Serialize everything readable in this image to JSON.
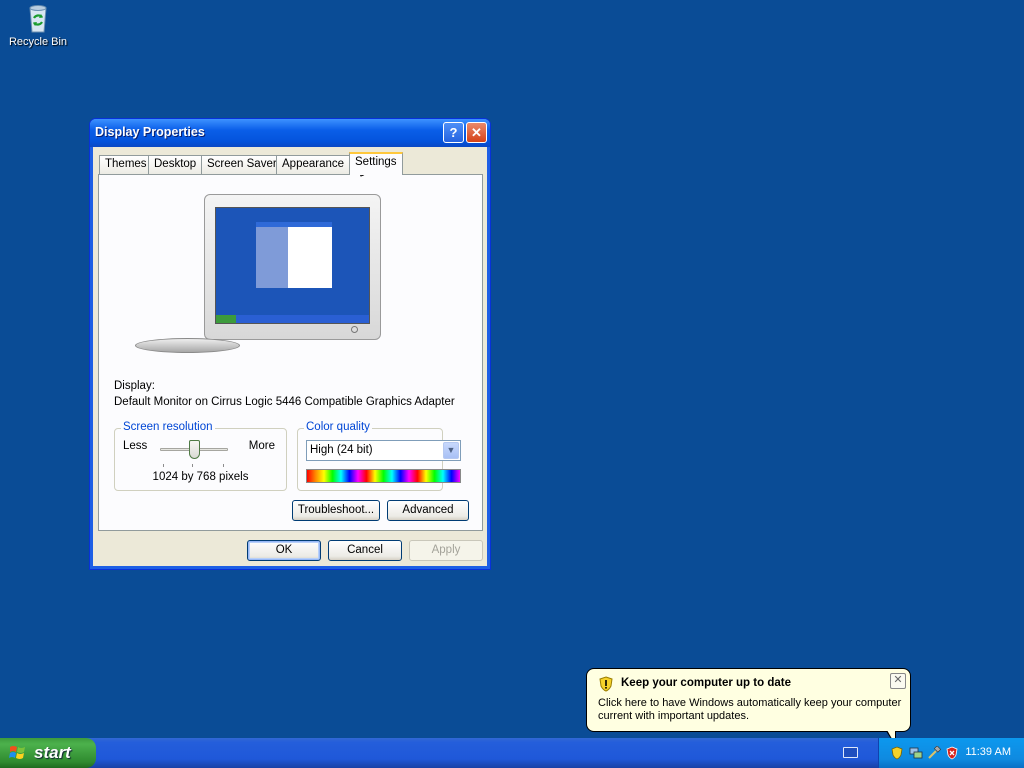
{
  "desktop": {
    "icons": [
      {
        "label": "Recycle Bin",
        "icon": "recycle-bin-icon"
      }
    ]
  },
  "window": {
    "title": "Display Properties",
    "controls": {
      "help": "?",
      "close": "✕"
    },
    "tabs": [
      {
        "label": "Themes"
      },
      {
        "label": "Desktop"
      },
      {
        "label": "Screen Saver"
      },
      {
        "label": "Appearance"
      },
      {
        "label": "Settings",
        "active": true
      }
    ],
    "display_label": "Display:",
    "display_value": "Default Monitor on Cirrus Logic 5446 Compatible Graphics Adapter",
    "screen_resolution": {
      "legend": "Screen resolution",
      "less": "Less",
      "more": "More",
      "value": "1024 by 768 pixels",
      "slider_fraction": 0.5
    },
    "color_quality": {
      "legend": "Color quality",
      "selected": "High (24 bit)"
    },
    "buttons": {
      "troubleshoot": "Troubleshoot...",
      "advanced": "Advanced",
      "ok": "OK",
      "cancel": "Cancel",
      "apply": "Apply"
    }
  },
  "taskbar": {
    "start_label": "start",
    "clock": "11:39 AM",
    "tray_icons": [
      "security-shield-icon",
      "network-icon",
      "update-icon",
      "security-center-icon"
    ]
  },
  "balloon": {
    "title": "Keep your computer up to date",
    "text": "Click here to have Windows automatically keep your computer current with important updates.",
    "close": "✕"
  },
  "colors": {
    "desktop": "#0a4c96",
    "title_bar": "#0453dc",
    "taskbar": "#245edb",
    "start_button": "#3c9b3c",
    "group_legend": "#0046d5",
    "balloon": "#ffffe1"
  }
}
